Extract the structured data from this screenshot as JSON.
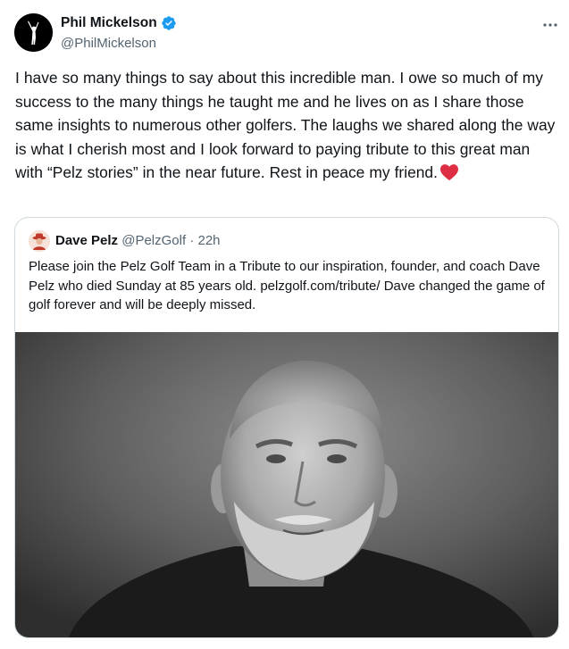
{
  "author": {
    "name": "Phil Mickelson",
    "handle": "@PhilMickelson"
  },
  "body": {
    "text": "I have so many things to say about this incredible man. I owe so much of my success to the many things he taught me and he lives on as I share those same insights to numerous other golfers. The laughs we shared along the way is what I cherish most and I look forward to paying tribute to this great man with “Pelz stories” in the near future. Rest in peace my friend."
  },
  "quoted": {
    "name": "Dave Pelz",
    "handle": "@PelzGolf",
    "separator": "·",
    "time": "22h",
    "text": "Please join the Pelz Golf Team in a Tribute to our inspiration, founder, and coach Dave Pelz who died Sunday at 85 years old. pelzgolf.com/tribute/ Dave changed the game of golf forever and will be deeply missed."
  },
  "icons": {
    "verified": "verified-badge-icon",
    "more": "more-dots-icon",
    "heart": "red-heart-emoji"
  },
  "colors": {
    "verified_blue": "#1d9bf0",
    "heart_red": "#e0245e",
    "secondary_text": "#536471",
    "border": "#cfd9de"
  }
}
